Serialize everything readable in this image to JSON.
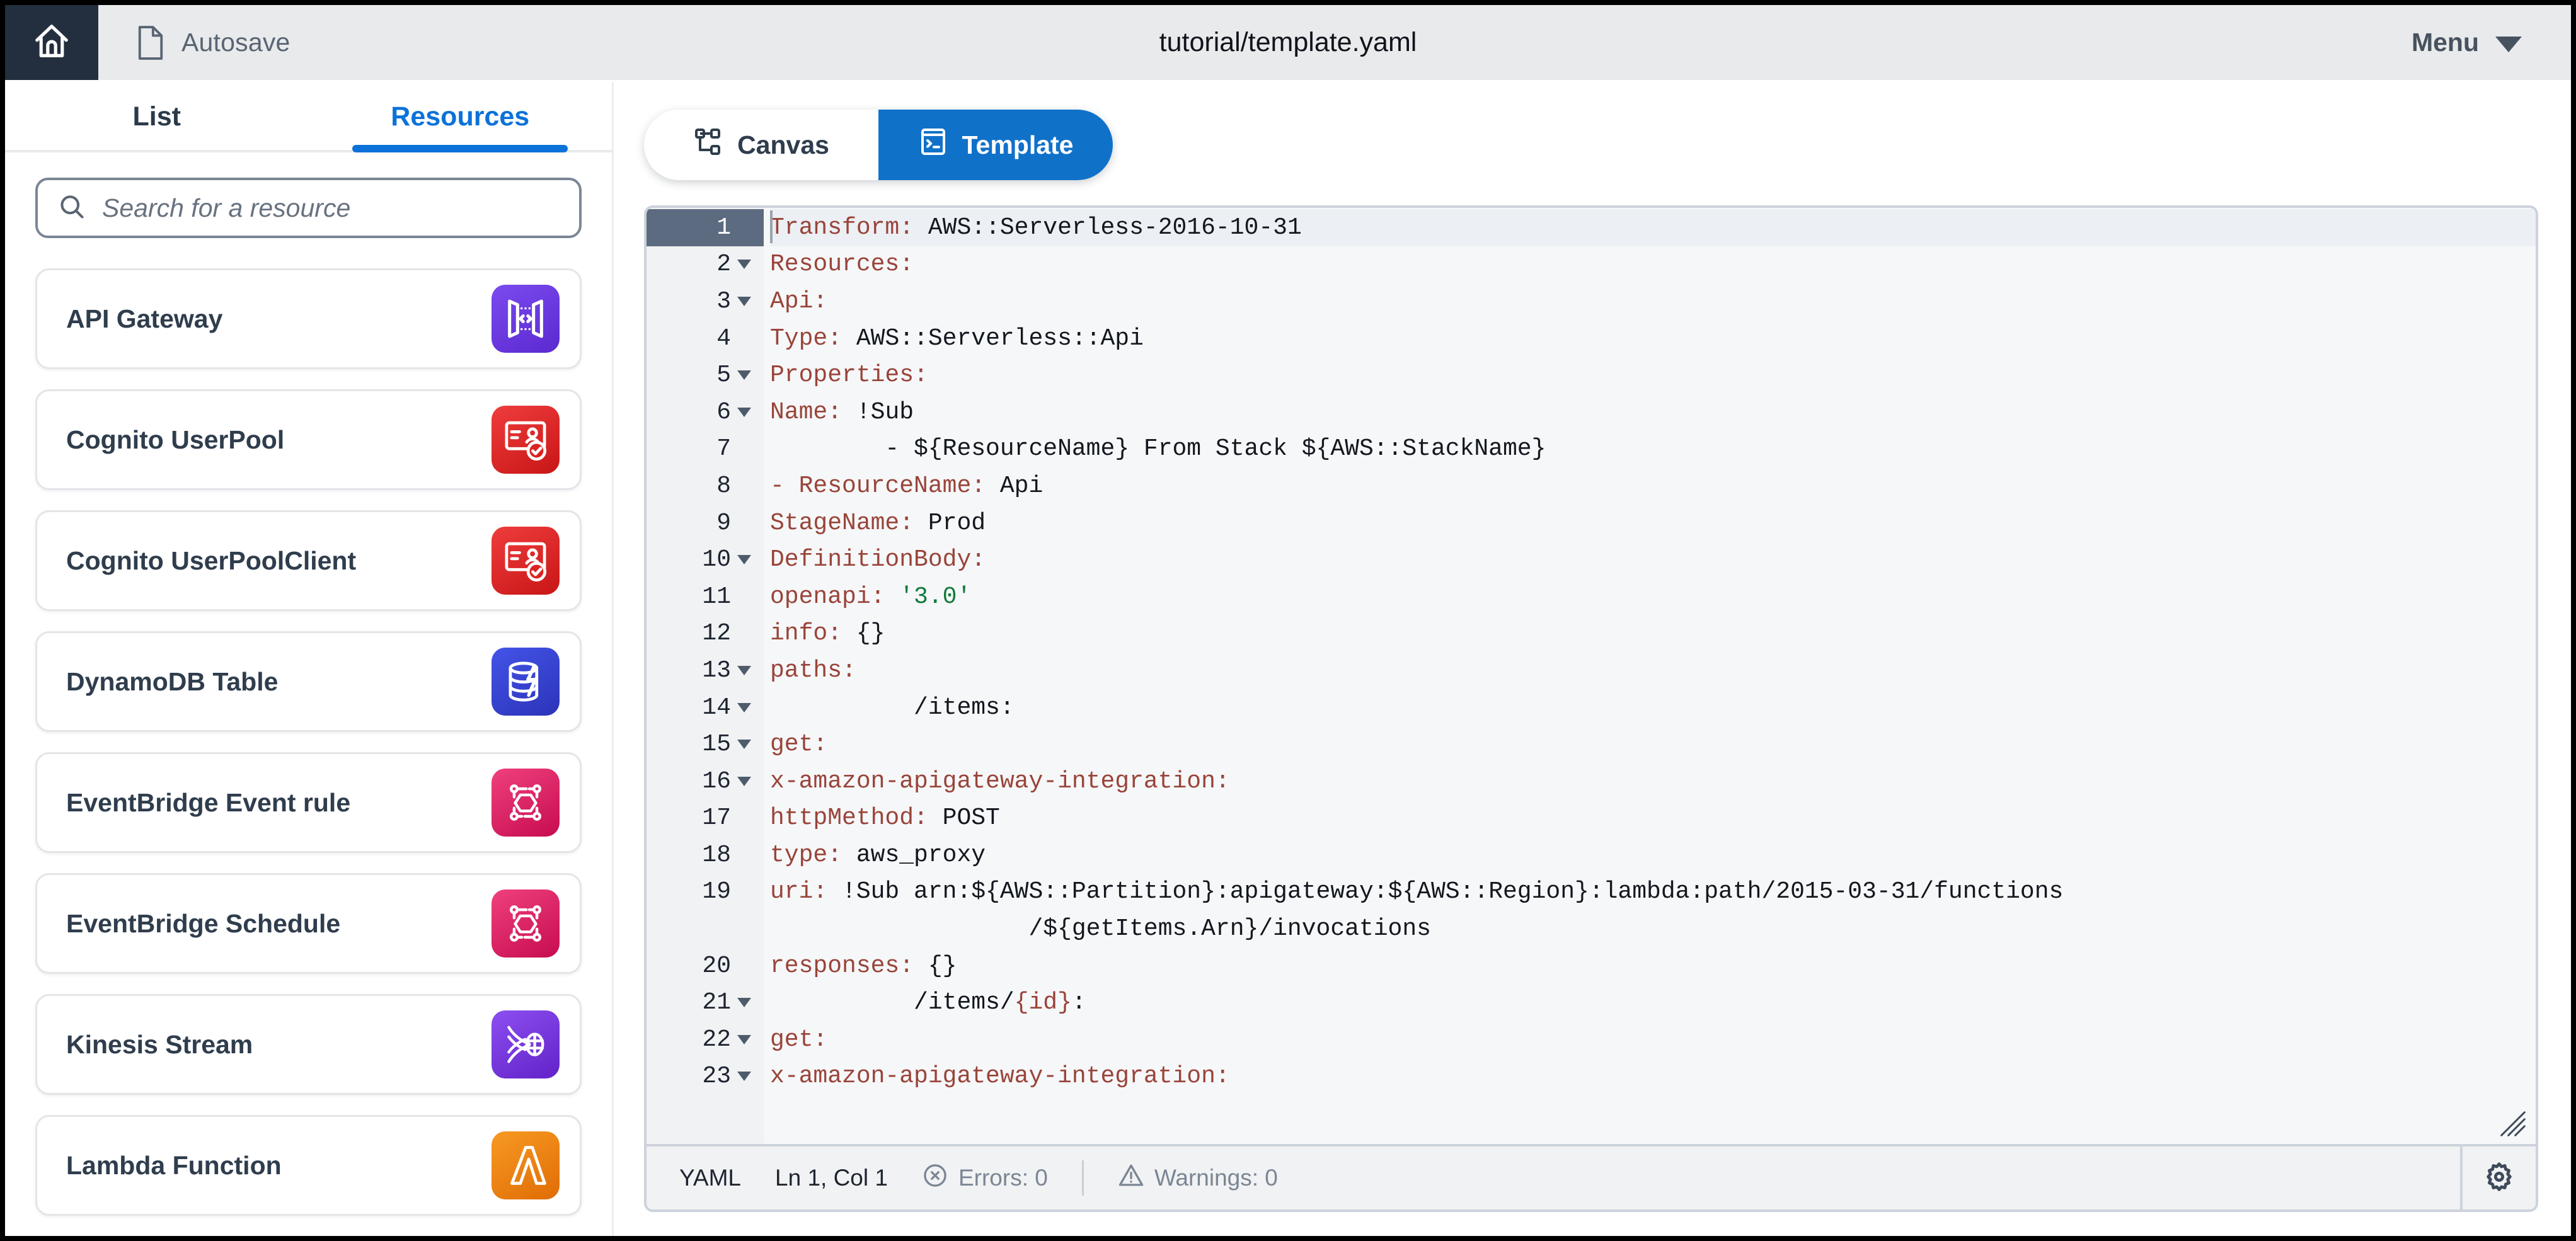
{
  "topbar": {
    "home_icon": "home-icon",
    "file_icon": "file-icon",
    "file_label": "Autosave",
    "title": "tutorial/template.yaml",
    "menu_label": "Menu",
    "menu_caret_icon": "chevron-down-icon"
  },
  "sidebar": {
    "tabs": [
      {
        "label": "List",
        "active": false
      },
      {
        "label": "Resources",
        "active": true
      }
    ],
    "search": {
      "icon": "search-icon",
      "placeholder": "Search for a resource",
      "value": ""
    },
    "resources": [
      {
        "label": "API Gateway",
        "icon": "api-gateway-icon",
        "color": "#6f3ee0"
      },
      {
        "label": "Cognito UserPool",
        "icon": "cognito-userpool-icon",
        "color": "#e02d2d"
      },
      {
        "label": "Cognito UserPoolClient",
        "icon": "cognito-userpool-icon",
        "color": "#e02d2d"
      },
      {
        "label": "DynamoDB Table",
        "icon": "dynamodb-icon",
        "color": "#3545cc"
      },
      {
        "label": "EventBridge Event rule",
        "icon": "eventbridge-icon",
        "color": "#e0175e"
      },
      {
        "label": "EventBridge Schedule",
        "icon": "eventbridge-icon",
        "color": "#e0175e"
      },
      {
        "label": "Kinesis Stream",
        "icon": "kinesis-icon",
        "color": "#7230d6"
      },
      {
        "label": "Lambda Function",
        "icon": "lambda-icon",
        "color": "#ee8413"
      }
    ]
  },
  "main": {
    "view_toggle": [
      {
        "label": "Canvas",
        "icon": "canvas-hierarchy-icon",
        "active": false
      },
      {
        "label": "Template",
        "icon": "template-terminal-icon",
        "active": true
      }
    ]
  },
  "editor": {
    "language": "YAML",
    "cursor": "Ln 1, Col 1",
    "errors_icon": "error-circle-icon",
    "errors_label": "Errors: 0",
    "warnings_icon": "warning-triangle-icon",
    "warnings_label": "Warnings: 0",
    "settings_icon": "gear-icon",
    "resize_icon": "resize-grip-icon",
    "active_line": 1,
    "lines": [
      {
        "n": 1,
        "fold": false,
        "indent": 0,
        "key": "Transform:",
        "value": " AWS::Serverless-2016-10-31"
      },
      {
        "n": 2,
        "fold": true,
        "indent": 0,
        "key": "Resources:",
        "value": ""
      },
      {
        "n": 3,
        "fold": true,
        "indent": 2,
        "key": "Api:",
        "value": ""
      },
      {
        "n": 4,
        "fold": false,
        "indent": 4,
        "key": "Type:",
        "value": " AWS::Serverless::Api"
      },
      {
        "n": 5,
        "fold": true,
        "indent": 4,
        "key": "Properties:",
        "value": ""
      },
      {
        "n": 6,
        "fold": true,
        "indent": 6,
        "key": "Name:",
        "value": " !Sub"
      },
      {
        "n": 7,
        "fold": false,
        "indent": 8,
        "key": "",
        "value": "- ${ResourceName} From Stack ${AWS::StackName}"
      },
      {
        "n": 8,
        "fold": false,
        "indent": 8,
        "key": "- ResourceName:",
        "value": " Api"
      },
      {
        "n": 9,
        "fold": false,
        "indent": 6,
        "key": "StageName:",
        "value": " Prod"
      },
      {
        "n": 10,
        "fold": true,
        "indent": 6,
        "key": "DefinitionBody:",
        "value": ""
      },
      {
        "n": 11,
        "fold": false,
        "indent": 8,
        "key": "openapi:",
        "value": "",
        "string": " '3.0'"
      },
      {
        "n": 12,
        "fold": false,
        "indent": 8,
        "key": "info:",
        "value": " {}"
      },
      {
        "n": 13,
        "fold": true,
        "indent": 8,
        "key": "paths:",
        "value": ""
      },
      {
        "n": 14,
        "fold": true,
        "indent": 10,
        "key": "",
        "value": "/items:"
      },
      {
        "n": 15,
        "fold": true,
        "indent": 12,
        "key": "get:",
        "value": ""
      },
      {
        "n": 16,
        "fold": true,
        "indent": 14,
        "key": "x-amazon-apigateway-integration:",
        "value": ""
      },
      {
        "n": 17,
        "fold": false,
        "indent": 16,
        "key": "httpMethod:",
        "value": " POST"
      },
      {
        "n": 18,
        "fold": false,
        "indent": 16,
        "key": "type:",
        "value": " aws_proxy"
      },
      {
        "n": 19,
        "fold": false,
        "indent": 16,
        "key": "uri:",
        "value": " !Sub arn:${AWS::Partition}:apigateway:${AWS::Region}:lambda:path/2015-03-31/functions"
      },
      {
        "n": "",
        "fold": false,
        "indent": 18,
        "key": "",
        "value": "/${getItems.Arn}/invocations",
        "cont": true
      },
      {
        "n": 20,
        "fold": false,
        "indent": 14,
        "key": "responses:",
        "value": " {}"
      },
      {
        "n": 21,
        "fold": true,
        "indent": 10,
        "key": "",
        "value": "/items/",
        "keytail": "{id}",
        "tail": ":"
      },
      {
        "n": 22,
        "fold": true,
        "indent": 12,
        "key": "get:",
        "value": ""
      },
      {
        "n": 23,
        "fold": true,
        "indent": 14,
        "key": "x-amazon-apigateway-integration:",
        "value": ""
      }
    ]
  },
  "colors": {
    "accent": "#0b72d9",
    "active_segment": "#1071c9",
    "topbar_bg": "#e9eaec",
    "home_bg": "#232f3e",
    "yaml_key": "#99443a",
    "yaml_string": "#117a3d",
    "active_line_gutter": "#5c6b7f"
  }
}
